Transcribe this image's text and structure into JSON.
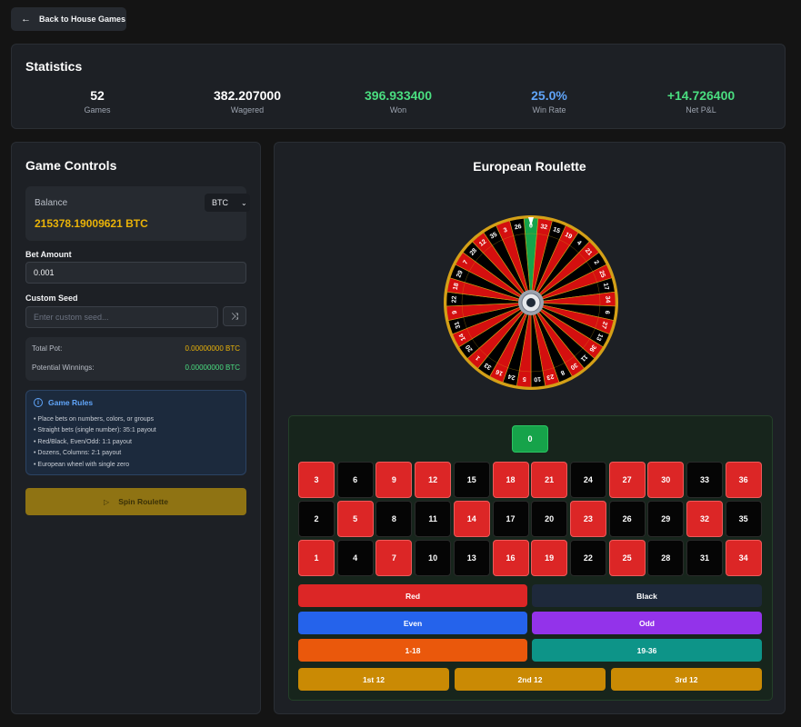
{
  "nav": {
    "back_label": "Back to House Games"
  },
  "statistics": {
    "title": "Statistics",
    "items": [
      {
        "value": "52",
        "label": "Games",
        "color": "#ffffff"
      },
      {
        "value": "382.207000",
        "label": "Wagered",
        "color": "#ffffff"
      },
      {
        "value": "396.933400",
        "label": "Won",
        "color": "#4ade80"
      },
      {
        "value": "25.0%",
        "label": "Win Rate",
        "color": "#60a5fa"
      },
      {
        "value": "+14.726400",
        "label": "Net P&L",
        "color": "#4ade80"
      }
    ]
  },
  "controls": {
    "title": "Game Controls",
    "balance_label": "Balance",
    "currency": "BTC",
    "balance_amount": "215378.19009621 BTC",
    "bet_amount_label": "Bet Amount",
    "bet_amount_value": "0.001",
    "seed_label": "Custom Seed",
    "seed_placeholder": "Enter custom seed...",
    "total_pot_label": "Total Pot:",
    "total_pot_value": "0.00000000 BTC",
    "potential_label": "Potential Winnings:",
    "potential_value": "0.00000000 BTC",
    "rules_title": "Game Rules",
    "rules": [
      "• Place bets on numbers, colors, or groups",
      "• Straight bets (single number): 35:1 payout",
      "• Red/Black, Even/Odd: 1:1 payout",
      "• Dozens, Columns: 2:1 payout",
      "• European wheel with single zero"
    ],
    "spin_label": "Spin Roulette"
  },
  "game": {
    "title": "European Roulette",
    "wheel_sequence": [
      0,
      32,
      15,
      19,
      4,
      21,
      2,
      25,
      17,
      34,
      6,
      27,
      13,
      36,
      11,
      30,
      8,
      23,
      10,
      5,
      24,
      16,
      33,
      1,
      20,
      14,
      31,
      9,
      22,
      18,
      29,
      7,
      28,
      12,
      35,
      3,
      26
    ],
    "red_numbers": [
      1,
      3,
      5,
      7,
      9,
      12,
      14,
      16,
      18,
      19,
      21,
      23,
      25,
      27,
      30,
      32,
      34,
      36
    ],
    "board": {
      "zero": "0",
      "rows": [
        [
          3,
          6,
          9,
          12,
          15,
          18,
          21,
          24,
          27,
          30,
          33,
          36
        ],
        [
          2,
          5,
          8,
          11,
          14,
          17,
          20,
          23,
          26,
          29,
          32,
          35
        ],
        [
          1,
          4,
          7,
          10,
          13,
          16,
          19,
          22,
          25,
          28,
          31,
          34
        ]
      ]
    },
    "bets": {
      "red": "Red",
      "black": "Black",
      "even": "Even",
      "odd": "Odd",
      "low": "1-18",
      "high": "19-36",
      "dozen1": "1st 12",
      "dozen2": "2nd 12",
      "dozen3": "3rd 12"
    },
    "colors": {
      "red": "#dc2626",
      "black": "#1e293b",
      "even": "#2563eb",
      "odd": "#9333ea",
      "low": "#ea580c",
      "high": "#0d9488",
      "dozen": "#ca8a04",
      "zero": "#16a34a"
    }
  }
}
